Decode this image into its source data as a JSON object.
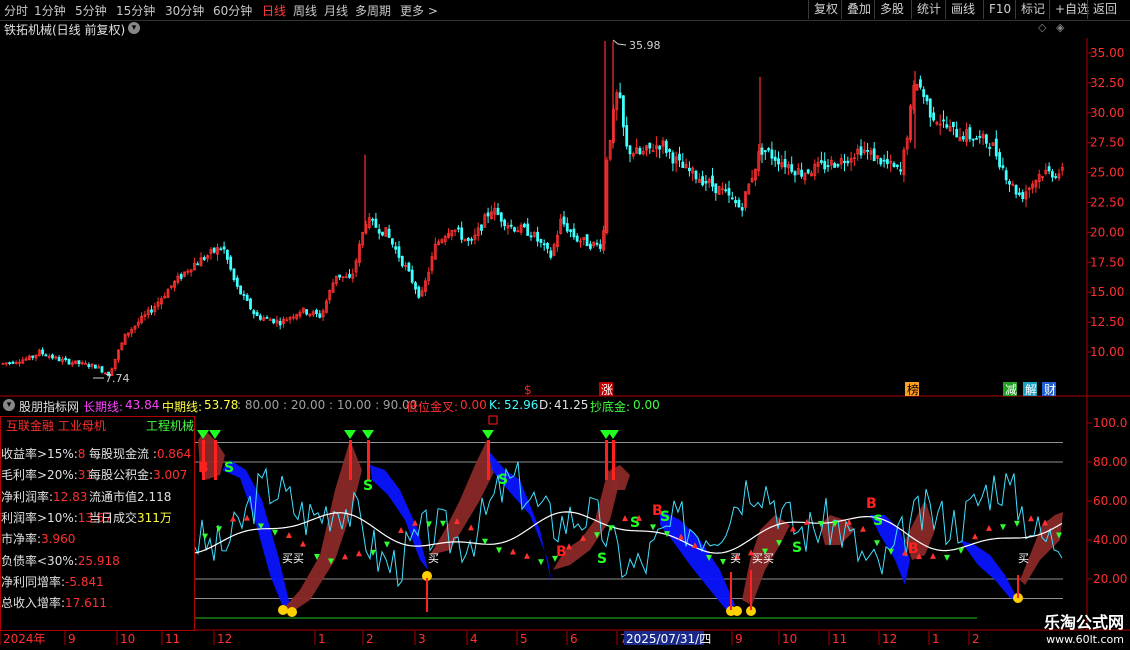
{
  "toolbar": {
    "periods": [
      "分时",
      "1分钟",
      "5分钟",
      "15分钟",
      "30分钟",
      "60分钟",
      "日线",
      "周线",
      "月线",
      "多周期",
      "更多 >"
    ],
    "active_period": "日线",
    "tools": [
      "复权",
      "叠加",
      "多股",
      "统计",
      "画线",
      "F10",
      "标记",
      "+自选",
      "返回"
    ]
  },
  "stock": {
    "title": "铁拓机械(日线 前复权)",
    "high_label": "35.98",
    "low_label": "7.74",
    "price_axis": [
      "35.00",
      "32.50",
      "30.00",
      "27.50",
      "25.00",
      "22.50",
      "20.00",
      "17.50",
      "15.00",
      "12.50",
      "10.00"
    ],
    "event_markers": [
      {
        "text": "$",
        "color": "#ff2020"
      },
      {
        "text": "涨",
        "color": "#ffffff",
        "bg": "#c00000"
      },
      {
        "text": "榜",
        "color": "#000000",
        "bg": "#ffa020"
      },
      {
        "text": "减",
        "color": "#ffffff",
        "bg": "#20a020"
      },
      {
        "text": "解",
        "color": "#ffffff",
        "bg": "#20a0c0"
      },
      {
        "text": "财",
        "color": "#ffffff",
        "bg": "#2060d0"
      }
    ]
  },
  "indicator": {
    "name": "股朋指标网",
    "long_line_label": "长期线:",
    "long_line_value": "43.84",
    "mid_line_label": "中期线:",
    "mid_line_value": "53.78",
    "levels_text": ": 80.00 : 20.00 : 10.00 : 90.00",
    "low_gold_label": "低位金叉:",
    "low_gold_value": "0.00",
    "k_label": "K:",
    "k_value": "52.96",
    "d_label": "D:",
    "d_value": "41.25",
    "bottom_gold_label": "抄底金:",
    "bottom_gold_value": "0.00",
    "y_axis": [
      "100.0",
      "80.00",
      "60.00",
      "40.00",
      "20.00"
    ],
    "signal_texts": [
      "买买",
      "买",
      "买",
      "买买",
      "买"
    ]
  },
  "fundamentals": {
    "header_left": "互联金融 工业母机",
    "header_right": "工程机械",
    "rows": [
      {
        "label": "收益率>15%:",
        "value": "8",
        "label2": "每股现金流 :",
        "value2": "0.864"
      },
      {
        "label": "毛利率>20%:",
        "value": "31",
        "label2": "每股公积金:",
        "value2": "3.007"
      },
      {
        "label": "净利润率:",
        "value": "12.83",
        "label2": "流通市值",
        "value2": "2.118"
      },
      {
        "label": "利润率>10%:",
        "value": "13.67",
        "label2": "当日成交",
        "value2": "311万"
      },
      {
        "label": "市净率:",
        "value": "3.960",
        "label2": "",
        "value2": ""
      },
      {
        "label": "负债率<30%:",
        "value": "25.918",
        "label2": "",
        "value2": ""
      },
      {
        "label": "净利同增率:",
        "value": "-5.841",
        "label2": "",
        "value2": ""
      },
      {
        "label": "总收入增率:",
        "value": "17.611",
        "label2": "",
        "value2": ""
      }
    ]
  },
  "timeline": {
    "labels": [
      "2024年",
      "9",
      "10",
      "11",
      "12",
      "1",
      "2",
      "3",
      "4",
      "5",
      "6",
      "7",
      "8",
      "9",
      "10",
      "11",
      "12",
      "1",
      "2",
      "3"
    ],
    "cursor_date": "2025/07/31/四"
  },
  "watermark": {
    "title": "乐淘公式网",
    "url": "www.60lt.com"
  },
  "colors": {
    "up": "#ff3030",
    "down": "#40ffff",
    "ribbon_blue": "#0a14ff",
    "ribbon_brown": "#8a2828"
  }
}
